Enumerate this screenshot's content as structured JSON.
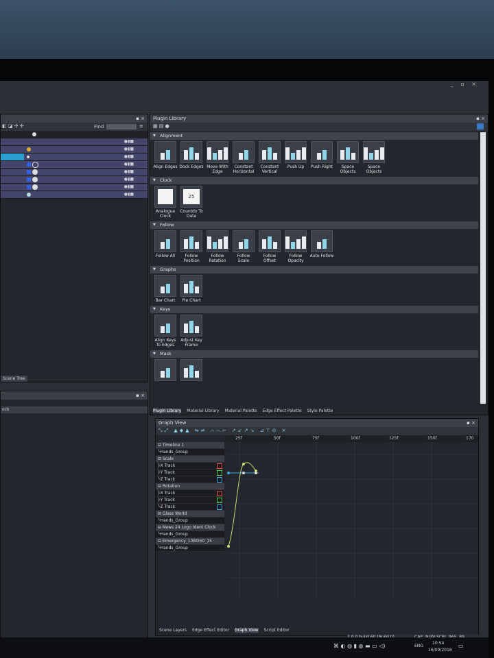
{
  "window": {
    "controls": "_ ▫ ×"
  },
  "left_panel": {
    "find_label": "Find",
    "scene_tree_tab": "Scene Tree",
    "bottom_label": "ock"
  },
  "plugin_library": {
    "title": "Plugin Library",
    "categories": [
      {
        "name": "Alignment",
        "items": [
          "Align Edges",
          "Dock Edges",
          "Move With Edge",
          "Constant Horizontal",
          "Constant Vertical",
          "Push Up",
          "Push Right",
          "Space Objects",
          "Space Objects"
        ]
      },
      {
        "name": "Clock",
        "items": [
          "Analogue Clock",
          "Countdo To Date"
        ]
      },
      {
        "name": "Follow",
        "items": [
          "Follow All",
          "Follow Position",
          "Follow Rotation",
          "Follow Scale",
          "Follow Offset",
          "Follow Opacity",
          "Auto Follow"
        ]
      },
      {
        "name": "Graphs",
        "items": [
          "Bar Chart",
          "Pie Chart"
        ]
      },
      {
        "name": "Keys",
        "items": [
          "Align Keys To Edges",
          "Adjust Key Frame"
        ]
      },
      {
        "name": "Mask",
        "items": [
          "",
          ""
        ]
      }
    ],
    "countdown_number": "25",
    "tabs": [
      "Plugin Library",
      "Material Library",
      "Material Palette",
      "Edge Effect Palette",
      "Style Palette"
    ]
  },
  "graph_view": {
    "title": "Graph View",
    "ruler": [
      "25f",
      "50f",
      "75f",
      "100f",
      "125f",
      "150f",
      "170"
    ],
    "tracks": [
      {
        "label": "⊟ Timeline 1",
        "hdr": true
      },
      {
        "label": "  └Hands_Group",
        "hdr": false
      },
      {
        "label": "⊟ Scale",
        "hdr": true
      },
      {
        "label": "  ├X Track",
        "hdr": false,
        "color": "#e05050"
      },
      {
        "label": "  ├Y Track",
        "hdr": false,
        "color": "#50d050"
      },
      {
        "label": "  └Z Track",
        "hdr": false,
        "color": "#40a8e0"
      },
      {
        "label": "⊟ Rotation",
        "hdr": true
      },
      {
        "label": "  ├X Track",
        "hdr": false,
        "color": "#e05050"
      },
      {
        "label": "  ├Y Track",
        "hdr": false,
        "color": "#50d050"
      },
      {
        "label": "  └Z Track",
        "hdr": false,
        "color": "#40a8e0"
      },
      {
        "label": "⊟ Glass World",
        "hdr": true
      },
      {
        "label": "  └Hands_Group",
        "hdr": false
      },
      {
        "label": "⊟ News 24 Logo Ident Clock",
        "hdr": true
      },
      {
        "label": "  └Hands_Group",
        "hdr": false
      },
      {
        "label": "⊟ Emergency_1080i50_15",
        "hdr": true
      },
      {
        "label": "  └Hands_Group",
        "hdr": false
      }
    ],
    "bottom_tabs": [
      "Scene Layers",
      "Edge Effect Editor",
      "Graph View",
      "Script Editor"
    ]
  },
  "status_bar": {
    "build": "2.0.0 build 60 (Build 0)",
    "flags": [
      "CAP",
      "NUM",
      "SCRL"
    ],
    "coords": "965, 89"
  },
  "taskbar": {
    "lang": "ENG",
    "time": "10:54",
    "date": "16/09/2018"
  }
}
